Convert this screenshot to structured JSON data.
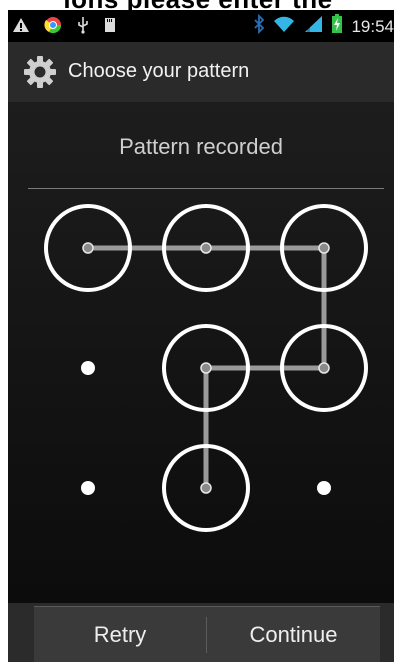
{
  "page_caption": "ions please enter the",
  "status_bar": {
    "time": "19:54",
    "left_icons": [
      "warning-icon",
      "chrome-icon",
      "usb-icon",
      "sd-card-icon"
    ],
    "right_icons": [
      "bluetooth-icon",
      "wifi-icon",
      "signal-icon",
      "battery-charging-icon"
    ]
  },
  "action_bar": {
    "icon": "gear-icon",
    "title": "Choose your pattern"
  },
  "main": {
    "header": "Pattern recorded"
  },
  "pattern": {
    "grid_size": 3,
    "sequence": [
      1,
      2,
      3,
      6,
      5,
      8
    ],
    "colors": {
      "ring": "#ffffff",
      "line": "#9a9a9a",
      "dot": "#ffffff"
    }
  },
  "footer": {
    "retry_label": "Retry",
    "continue_label": "Continue"
  },
  "colors": {
    "status_bar": "#000000",
    "action_bar": "#2a2a2a",
    "accent_signal": "#33b5e5",
    "battery": "#34c24a"
  }
}
